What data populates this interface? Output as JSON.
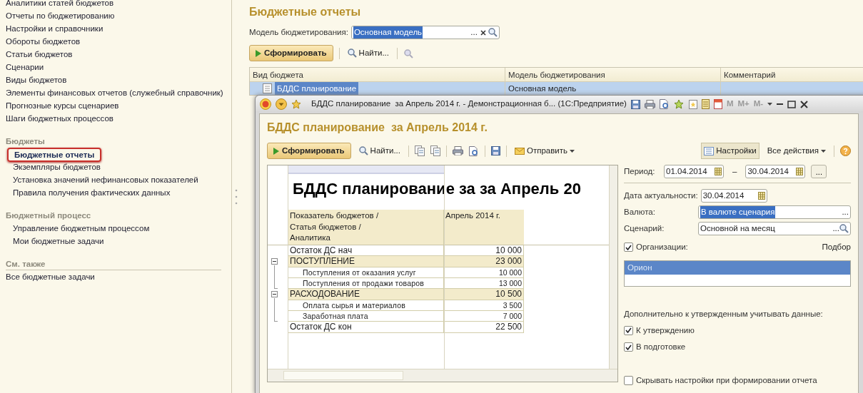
{
  "sidebar": {
    "links": [
      {
        "label": "Аналитики статей бюджетов"
      },
      {
        "label": "Отчеты по бюджетированию"
      },
      {
        "label": "Настройки и справочники"
      },
      {
        "label": "Обороты бюджетов"
      },
      {
        "label": "Статьи бюджетов"
      },
      {
        "label": "Сценарии"
      },
      {
        "label": "Виды  бюджетов"
      },
      {
        "label": "Элементы финансовых отчетов (служебный справочник)"
      },
      {
        "label": "Прогнозные курсы сценариев"
      },
      {
        "label": "Шаги бюджетных процессов"
      }
    ],
    "groups": [
      {
        "heading": "Бюджеты",
        "kind": "indented",
        "items": [
          {
            "label": "Бюджетные отчеты",
            "selected": true
          },
          {
            "label": "Экземпляры бюджетов",
            "selected": false
          },
          {
            "label": "Установка значений нефинансовых показателей",
            "selected": false
          },
          {
            "label": "Правила получения фактических данных",
            "selected": false
          }
        ]
      },
      {
        "heading": "Бюджетный процесс",
        "kind": "indented",
        "items": [
          {
            "label": "Управление бюджетным процессом",
            "selected": false
          },
          {
            "label": "Мои бюджетные задачи",
            "selected": false
          }
        ]
      },
      {
        "heading": "См. также",
        "kind": "plain",
        "items": [
          {
            "label": "Все бюджетные задачи",
            "selected": false
          }
        ]
      }
    ]
  },
  "main": {
    "title": "Бюджетные отчеты",
    "model_field": {
      "label": "Модель бюджетирования:",
      "value": "Основная модель",
      "more": "..."
    },
    "toolbar": {
      "generate": "Сформировать",
      "find": "Найти..."
    },
    "table": {
      "columns": [
        "Вид бюджета",
        "Модель бюджетирования",
        "Комментарий"
      ],
      "rows": [
        {
          "cells": [
            "БДДС планирование",
            "Основная модель"
          ],
          "selected": true
        }
      ]
    }
  },
  "report_window": {
    "title": "БДДС планирование  за Апрель 2014 г. - Демонстрационная б... (1С:Предприятие)",
    "memory_buttons": [
      "M",
      "M+",
      "M-"
    ],
    "heading": "БДДС планирование  за Апрель 2014 г.",
    "toolbar": {
      "generate": "Сформировать",
      "find": "Найти...",
      "send": "Отправить",
      "settings": "Настройки",
      "all_actions": "Все действия"
    },
    "sheet": {
      "title": "БДДС планирование за за Апрель 20",
      "columns": [
        "Показатель бюджетов /\nСтатья бюджетов /\nАналитика",
        "Апрель 2014 г."
      ],
      "rows": [
        {
          "label": "Остаток ДС нач",
          "value": "10 000",
          "kind": "total"
        },
        {
          "label": "ПОСТУПЛЕНИЕ",
          "value": "23 000",
          "kind": "group",
          "expanded": true,
          "children": [
            {
              "label": "Поступления от оказания услуг",
              "value": "10 000",
              "kind": "item"
            },
            {
              "label": "Поступления от продажи товаров",
              "value": "13 000",
              "kind": "item"
            }
          ]
        },
        {
          "label": "РАСХОДОВАНИЕ",
          "value": "10 500",
          "kind": "group",
          "expanded": true,
          "children": [
            {
              "label": "Оплата сырья и материалов",
              "value": "3 500",
              "kind": "item"
            },
            {
              "label": "Заработная плата",
              "value": "7 000",
              "kind": "item"
            }
          ]
        },
        {
          "label": "Остаток ДС кон",
          "value": "22 500",
          "kind": "total"
        }
      ]
    },
    "settings": {
      "period_label": "Период:",
      "period_from": "01.04.2014",
      "period_dash": "–",
      "period_to": "30.04.2014",
      "period_more": "...",
      "date_label": "Дата актуальности:",
      "date_value": "30.04.2014",
      "currency_label": "Валюта:",
      "currency_value": "В валюте сценария",
      "currency_more": "...",
      "scenario_label": "Сценарий:",
      "scenario_value": "Основной на месяц",
      "scenario_more": "...",
      "organizations": {
        "label": "Организации:",
        "checked": true,
        "pick": "Подбор",
        "items": [
          {
            "label": "Орион",
            "selected": true
          }
        ]
      },
      "extra_note": "Дополнительно к утвержденным учитывать данные:",
      "checkboxes": [
        {
          "label": "К утверждению",
          "checked": true
        },
        {
          "label": "В подготовке",
          "checked": true
        }
      ],
      "hide_settings": {
        "label": "Скрывать настройки при формировании отчета",
        "checked": false
      }
    }
  }
}
